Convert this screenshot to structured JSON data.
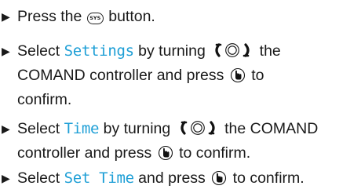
{
  "steps": [
    {
      "bullet": "▶",
      "pre": "Press the",
      "button_icon": "sys-button-icon",
      "button_text": "SYS",
      "post": "button."
    },
    {
      "bullet": "▶",
      "pre": "Select",
      "highlight": "Settings",
      "mid": "by turning",
      "rotate_icon": "rotate-controller-icon",
      "line1_end": "the",
      "line2": "COMAND controller and press",
      "press_icon": "press-controller-icon",
      "line2_end": "to",
      "line3": "confirm."
    },
    {
      "bullet": "▶",
      "pre": "Select",
      "highlight": "Time",
      "mid": "by turning",
      "rotate_icon": "rotate-controller-icon",
      "line1_end": "the COMAND",
      "line2": "controller and press",
      "press_icon": "press-controller-icon",
      "line2_end": "to confirm."
    },
    {
      "bullet": "▶",
      "pre": "Select",
      "highlight": "Set Time",
      "mid": "and press",
      "press_icon": "press-controller-icon",
      "post": "to confirm."
    }
  ],
  "colors": {
    "highlight": "#1e9fd6",
    "text": "#1a1a1a"
  }
}
